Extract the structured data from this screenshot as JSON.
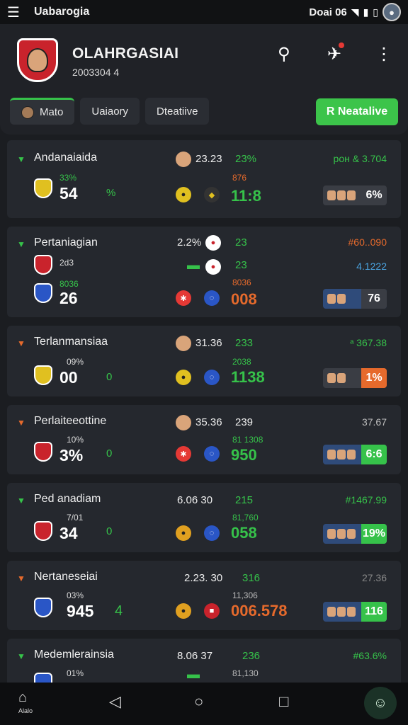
{
  "status": {
    "app_title": "Uabarogia",
    "time": "Doai 06",
    "menu_icon": "menu-icon",
    "wifi_icon": "wifi-icon",
    "signal_icon": "signal-icon",
    "battery_icon": "battery-icon"
  },
  "header": {
    "name": "OLAHRGASIAI",
    "sub": "2003304 4",
    "search_icon": "person-search-icon",
    "notify_icon": "megaphone-icon",
    "more_icon": "more-vertical-icon"
  },
  "tabs": [
    {
      "label": "Mato"
    },
    {
      "label": "Uaiaory"
    },
    {
      "label": "Dteatiive"
    }
  ],
  "cta": {
    "label": "R Neatalive"
  },
  "matches": [
    {
      "name": "Andanaiaida",
      "chev": "▼",
      "small": "33%",
      "big": "54",
      "ratio": "%",
      "stat_top": "23.23",
      "mid_small": "23%",
      "mid_small2": "876",
      "mid_big": "11:8",
      "odd": "рон & 3.704",
      "chip_pct": "6%",
      "crest": "#e0c020"
    },
    {
      "name": "Pertaniagian",
      "chev": "▼",
      "small": "2d3",
      "small2": "8036",
      "big": "26",
      "ratio": "",
      "stat_top": "2.2%",
      "mid_small": "23",
      "mid_small2": "8036",
      "mid_big": "008",
      "odd": "#60..090",
      "odd2": "4.1222",
      "chip_pct": "76",
      "crest": "#c9232c"
    },
    {
      "name": "Terlanmansiaa",
      "chev": "▼",
      "small": "09%",
      "big": "00",
      "ratio": "0",
      "stat_top": "31.36",
      "mid_small": "233",
      "mid_small2": "2038",
      "mid_big": "1138",
      "odd": "ᵃ 367.38",
      "chip_pct": "1%",
      "crest": "#e0c020"
    },
    {
      "name": "Perlaiteeottine",
      "chev": "▼",
      "small": "10%",
      "big": "3%",
      "ratio": "0",
      "stat_top": "35.36",
      "mid_small": "239",
      "mid_small2": "81 1308",
      "mid_big": "950",
      "odd": "37.67",
      "chip_pct": "6:6",
      "crest": "#c9232c"
    },
    {
      "name": "Ped anadiam",
      "chev": "▼",
      "small": "7/01",
      "big": "34",
      "ratio": "0",
      "stat_top": "6.06 30",
      "mid_small": "215",
      "mid_small2": "81,760",
      "mid_big": "058",
      "odd": "#1467.99",
      "chip_pct": "19%",
      "crest": "#c9232c"
    },
    {
      "name": "Nertaneseiai",
      "chev": "▼",
      "small": "03%",
      "big": "945",
      "ratio": "4",
      "stat_top": "2.23. 30",
      "mid_small": "316",
      "mid_small2": "11,306",
      "mid_big": "006.578",
      "odd": "27.36",
      "chip_pct": "116",
      "crest": "#2a56c6"
    },
    {
      "name": "Medemlerainsia",
      "chev": "▼",
      "small": "01%",
      "big": "",
      "ratio": "",
      "stat_top": "8.06 37",
      "mid_small": "236",
      "mid_small2": "81,130",
      "mid_big": "",
      "odd": "#63.6%",
      "chip_pct": "",
      "crest": "#2a56c6"
    }
  ],
  "nav": {
    "home_label": "Alalo",
    "home_icon": "home-icon",
    "back_icon": "back-triangle-icon",
    "home_circle_icon": "home-circle-icon",
    "recent_icon": "recent-square-icon",
    "fab_icon": "chat-person-icon"
  }
}
